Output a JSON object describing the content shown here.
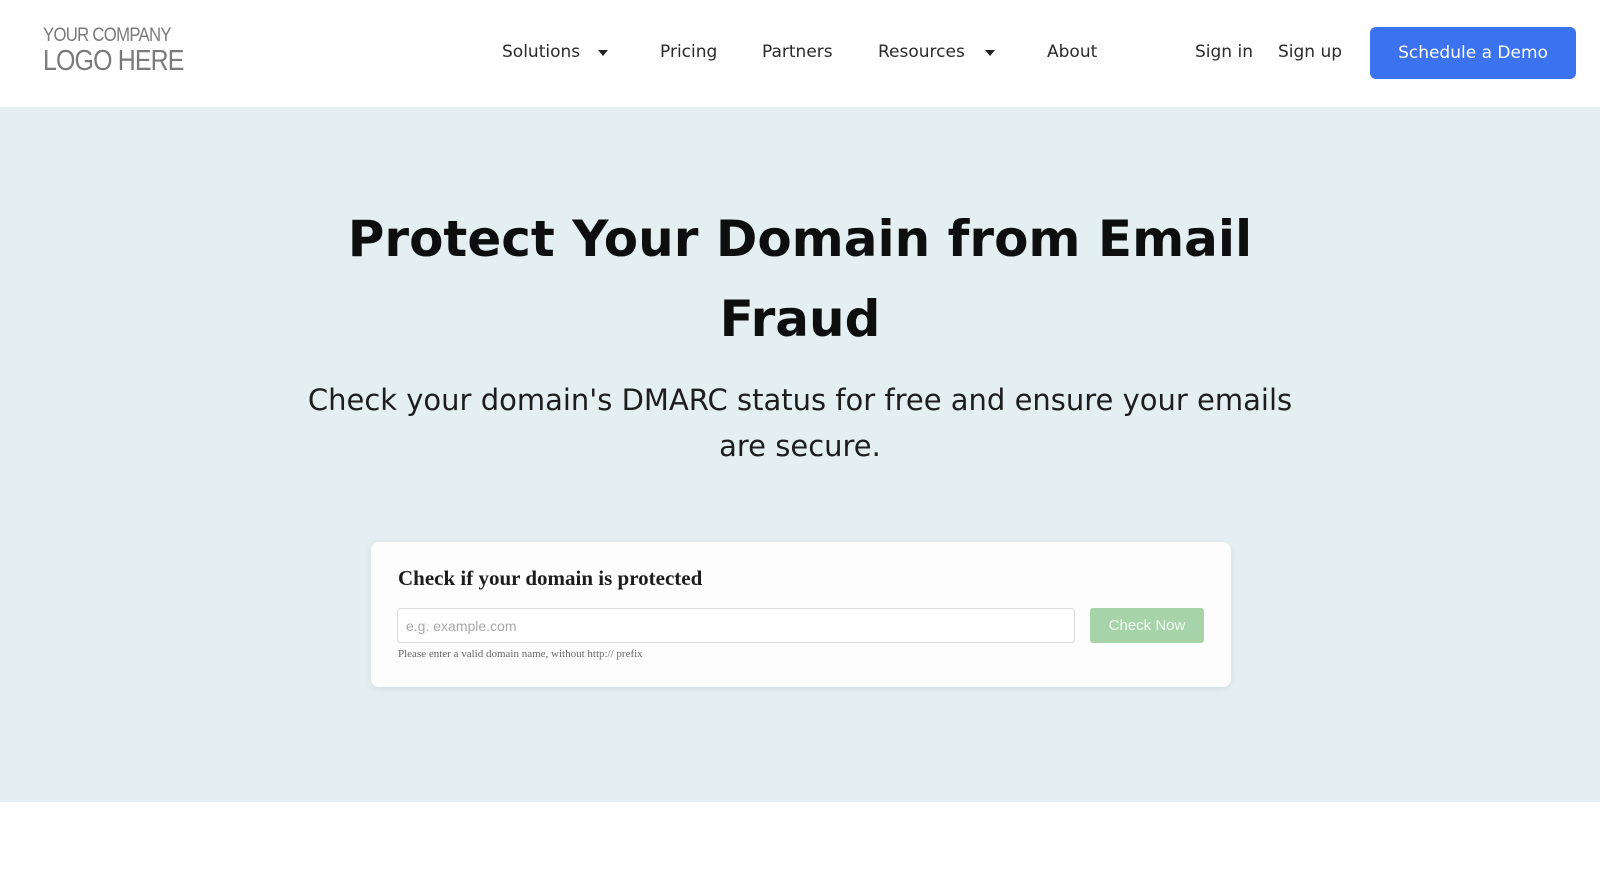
{
  "header": {
    "logo": {
      "line1": "YOUR COMPANY",
      "line2": "LOGO HERE"
    },
    "nav": {
      "solutions": "Solutions",
      "pricing": "Pricing",
      "partners": "Partners",
      "resources": "Resources",
      "about": "About"
    },
    "sign_in": "Sign in",
    "sign_up": "Sign up",
    "demo_button": "Schedule a Demo"
  },
  "hero": {
    "title_line1": "Protect Your Domain from Email",
    "title_line2": "Fraud",
    "subtitle_line1": "Check your domain's DMARC status for free and ensure your emails",
    "subtitle_line2": "are secure."
  },
  "checker": {
    "title": "Check if your domain is protected",
    "input_placeholder": "e.g. example.com",
    "input_value": "",
    "button": "Check Now",
    "hint": "Please enter a valid domain name, without http:// prefix"
  },
  "colors": {
    "accent": "#3b72f0",
    "hero_background": "#e4eff2",
    "check_button": "#a6d3a8"
  }
}
